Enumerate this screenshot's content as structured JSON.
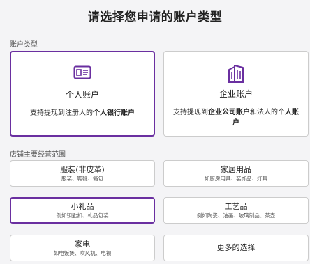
{
  "title": "请选择您申请的账户类型",
  "account_section_label": "账户类型",
  "account_cards": {
    "personal": {
      "icon": "id-card-icon",
      "title": "个人账户",
      "desc_prefix": "支持提现到注册人的",
      "desc_bold": "个人银行账户",
      "selected": true
    },
    "company": {
      "icon": "building-icon",
      "title": "企业账户",
      "desc_prefix": "支持提现到",
      "desc_bold": "企业公司账户",
      "desc_mid": "和法人的个",
      "desc_bold2": "人账户",
      "selected": false
    }
  },
  "scope_section_label": "店铺主要经营范围",
  "scope_options": [
    {
      "main": "服装(非皮革)",
      "sub": "服装、鞋靴、箱包",
      "selected": false
    },
    {
      "main": "家居用品",
      "sub": "如厨房用具、装饰品、灯具",
      "selected": false
    },
    {
      "main": "小礼品",
      "sub": "例如钥匙扣、礼品包装",
      "selected": true
    },
    {
      "main": "工艺品",
      "sub": "例如陶瓷、油画、玻璃制品、茶壶",
      "selected": false
    },
    {
      "main": "家电",
      "sub": "如电饭煲、吹风机、电视",
      "selected": false
    },
    {
      "main": "更多的选择",
      "sub": "",
      "selected": false
    }
  ],
  "colors": {
    "accent": "#6a2fa0",
    "border": "#cccccc",
    "background": "#f4f4f6"
  }
}
